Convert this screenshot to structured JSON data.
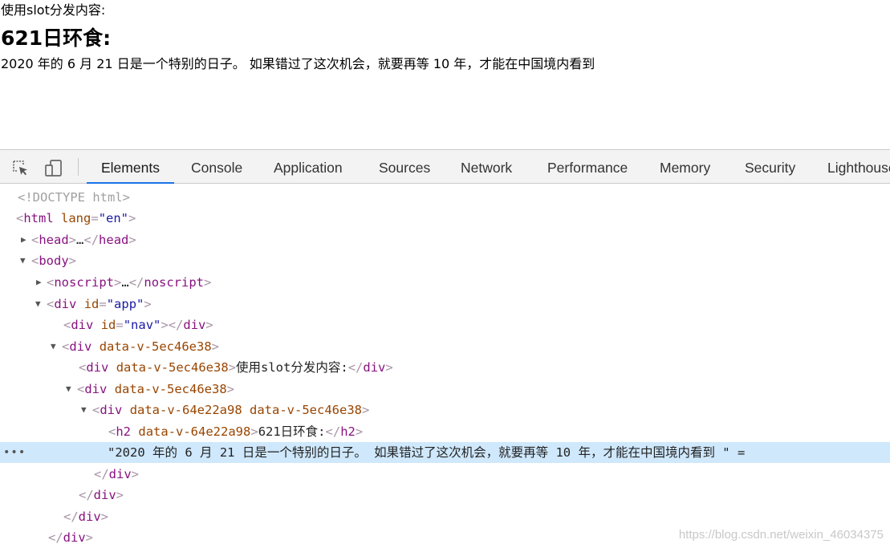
{
  "page": {
    "intro": "使用slot分发内容:",
    "heading": "621日环食:",
    "paragraph": "2020 年的 6 月 21 日是一个特别的日子。 如果错过了这次机会，就要再等 10 年，才能在中国境内看到"
  },
  "devtools": {
    "tabs": [
      "Elements",
      "Console",
      "Application",
      "Sources",
      "Network",
      "Performance",
      "Memory",
      "Security",
      "Lighthouse"
    ],
    "active_tab": "Elements",
    "icons": {
      "inspect": "inspect-element-icon",
      "device": "device-toolbar-icon"
    },
    "accent_color": "#1a73e8",
    "selected_row_color": "#cfe8fc",
    "dom": {
      "doctype": "<!DOCTYPE html>",
      "html_tag": "html",
      "lang_attr": "lang",
      "lang_val": "\"en\"",
      "head_tag": "head",
      "body_tag": "body",
      "noscript_tag": "noscript",
      "div_tag": "div",
      "h2_tag": "h2",
      "id_attr": "id",
      "app_val": "\"app\"",
      "nav_val": "\"nav\"",
      "scope_a": "data-v-5ec46e38",
      "scope_b": "data-v-64e22a98",
      "collapsed": "…",
      "intro_text": "使用slot分发内容:",
      "h2_text": "621日环食:",
      "text_node": "\"2020 年的 6 月 21 日是一个特别的日子。 如果错过了这次机会，就要再等 10 年，才能在中国境内看到 \" =",
      "row_menu": "•••"
    },
    "watermark": "https://blog.csdn.net/weixin_46034375"
  }
}
